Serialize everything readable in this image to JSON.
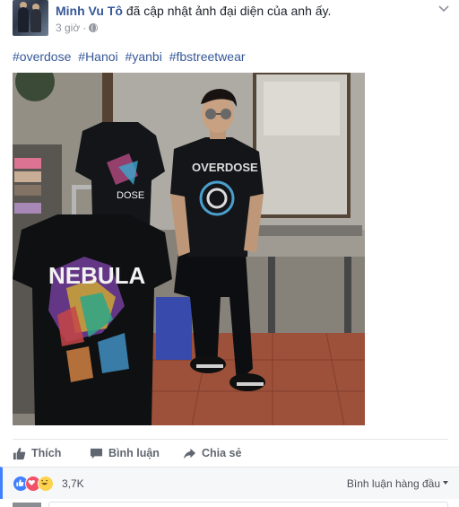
{
  "post": {
    "author": "Minh Vu Tô",
    "action_text": "đã cập nhật ảnh đại diện của anh ấy.",
    "timestamp": "3 giờ",
    "separator": "·",
    "hashtags": [
      "#overdose",
      "#Hanoi",
      "#yanbi",
      "#fbstreetwear"
    ],
    "photo": {
      "shirt_text_overdose": "OVERDOSE",
      "shirt_text_nebula": "NEBULA",
      "shirt_text_dose": "DOSE"
    }
  },
  "actions": {
    "like": "Thích",
    "comment": "Bình luận",
    "share": "Chia sẻ"
  },
  "reactions": {
    "icons": [
      "like-icon",
      "love-icon",
      "haha-icon"
    ],
    "count": "3,7K",
    "sort_label": "Bình luận hàng đầu"
  },
  "colors": {
    "link": "#365899",
    "accent": "#4080ff",
    "muted": "#90949c"
  }
}
